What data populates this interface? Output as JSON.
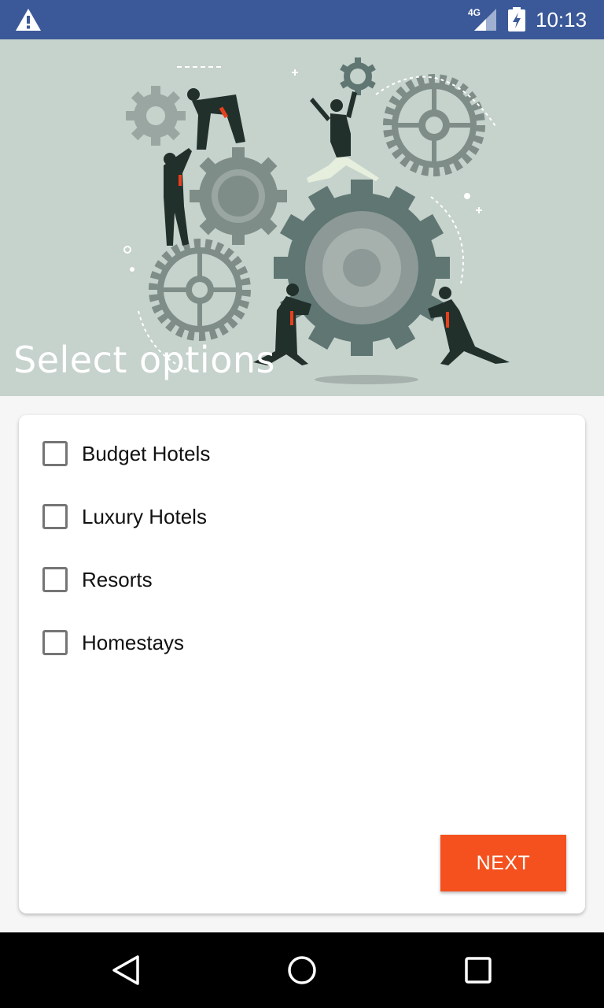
{
  "status_bar": {
    "network": "4G",
    "time": "10:13",
    "icons": [
      "warning-icon",
      "signal-icon",
      "battery-charging-icon"
    ]
  },
  "hero": {
    "title": "Select options",
    "illustration": "team-pushing-gears-illustration"
  },
  "options": [
    {
      "label": "Budget Hotels",
      "checked": false
    },
    {
      "label": "Luxury Hotels",
      "checked": false
    },
    {
      "label": "Resorts",
      "checked": false
    },
    {
      "label": "Homestays",
      "checked": false
    }
  ],
  "actions": {
    "next_label": "NEXT",
    "next_color": "#f4511e"
  },
  "colors": {
    "status_bar": "#3b5998",
    "hero_background": "#c6d2cc"
  },
  "nav_bar": {
    "icons": [
      "back-icon",
      "home-icon",
      "recents-icon"
    ]
  }
}
